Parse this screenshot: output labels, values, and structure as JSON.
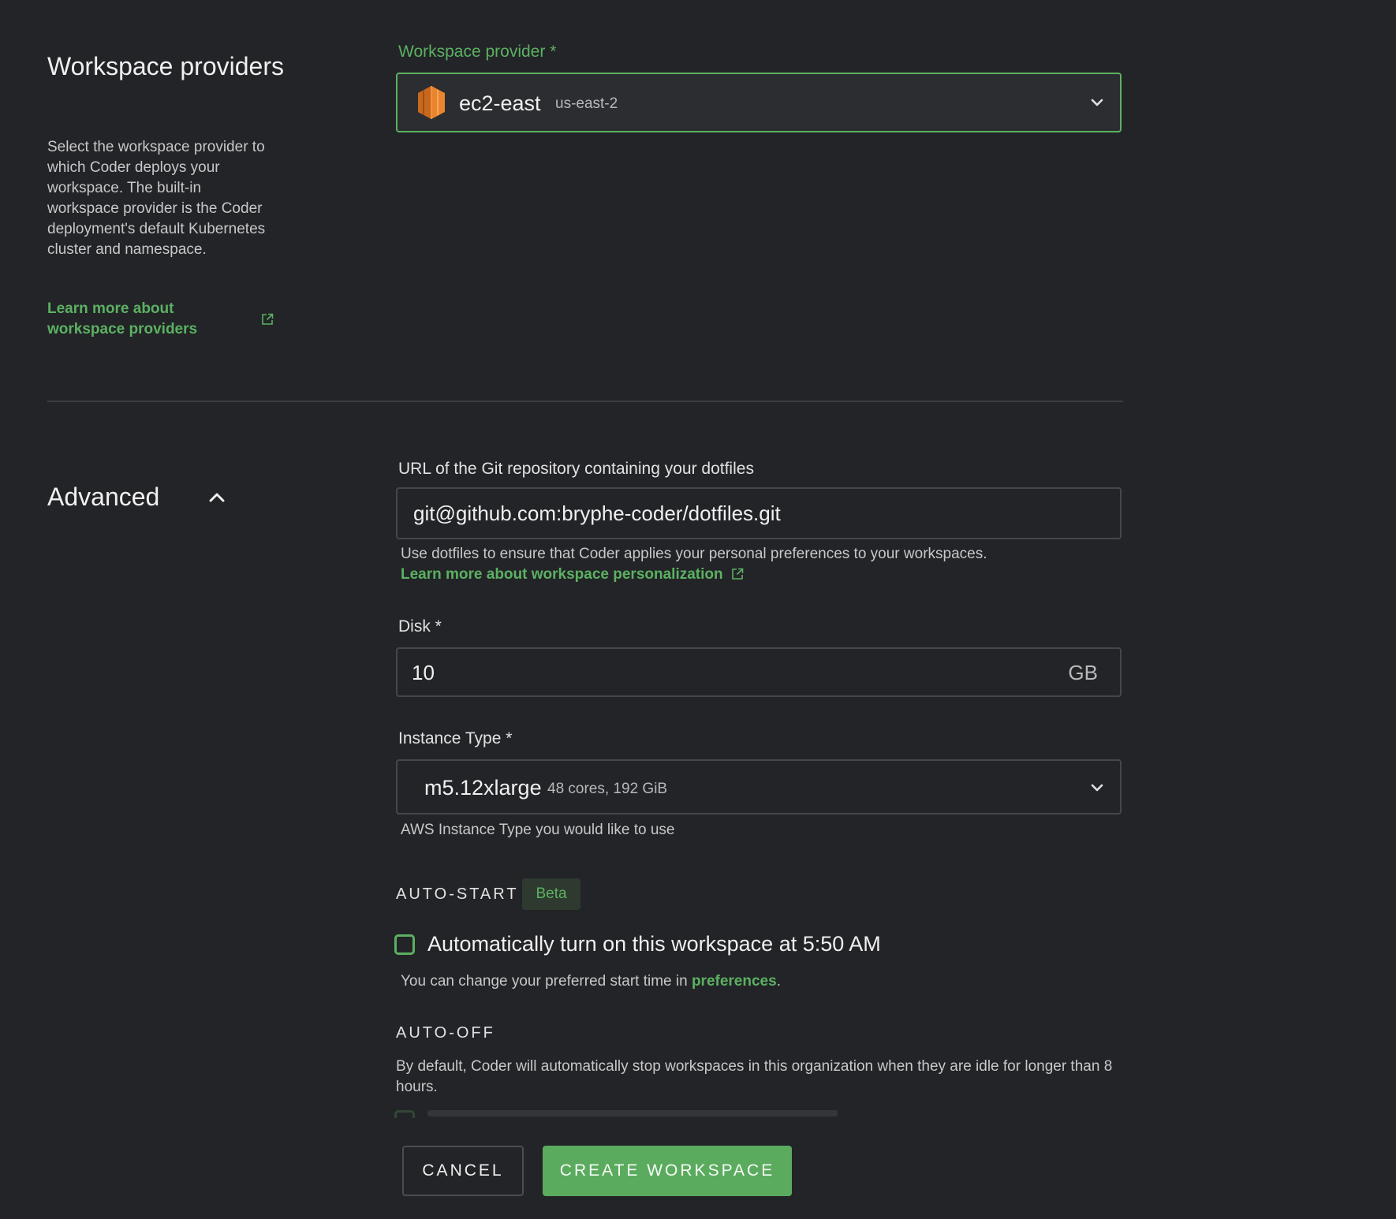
{
  "provider_section": {
    "title": "Workspace providers",
    "description": "Select the workspace provider to which Coder deploys your workspace. The built-in workspace provider is the Coder deployment's default Kubernetes cluster and namespace.",
    "learn_more_link": "Learn more about workspace providers",
    "field_label": "Workspace provider *",
    "selected_provider": {
      "name": "ec2-east",
      "region": "us-east-2",
      "icon": "aws-icon"
    }
  },
  "advanced_section": {
    "title": "Advanced",
    "expanded": true,
    "dotfiles": {
      "label": "URL of the Git repository containing your dotfiles",
      "value": "git@github.com:bryphe-coder/dotfiles.git",
      "helper": "Use dotfiles to ensure that Coder applies your personal preferences to your workspaces.",
      "learn_more_link": "Learn more about workspace personalization"
    },
    "disk": {
      "label": "Disk *",
      "value": "10",
      "unit": "GB"
    },
    "instance_type": {
      "label": "Instance Type *",
      "selected": "m5.12xlarge",
      "spec": "48 cores, 192 GiB",
      "helper": "AWS Instance Type you would like to use"
    },
    "auto_start": {
      "caption": "AUTO-START",
      "badge": "Beta",
      "checkbox_label": "Automatically turn on this workspace at 5:50 AM",
      "checked": false,
      "helper_prefix": "You can change your preferred start time in ",
      "helper_link": "preferences",
      "helper_suffix": "."
    },
    "auto_off": {
      "caption": "AUTO-OFF",
      "description": "By default, Coder will automatically stop workspaces in this organization when they are idle for longer than 8 hours."
    }
  },
  "footer": {
    "cancel_label": "CANCEL",
    "create_label": "CREATE WORKSPACE"
  },
  "colors": {
    "background": "#232427",
    "accent": "#5bb162",
    "aws_orange": "#e8852d"
  }
}
